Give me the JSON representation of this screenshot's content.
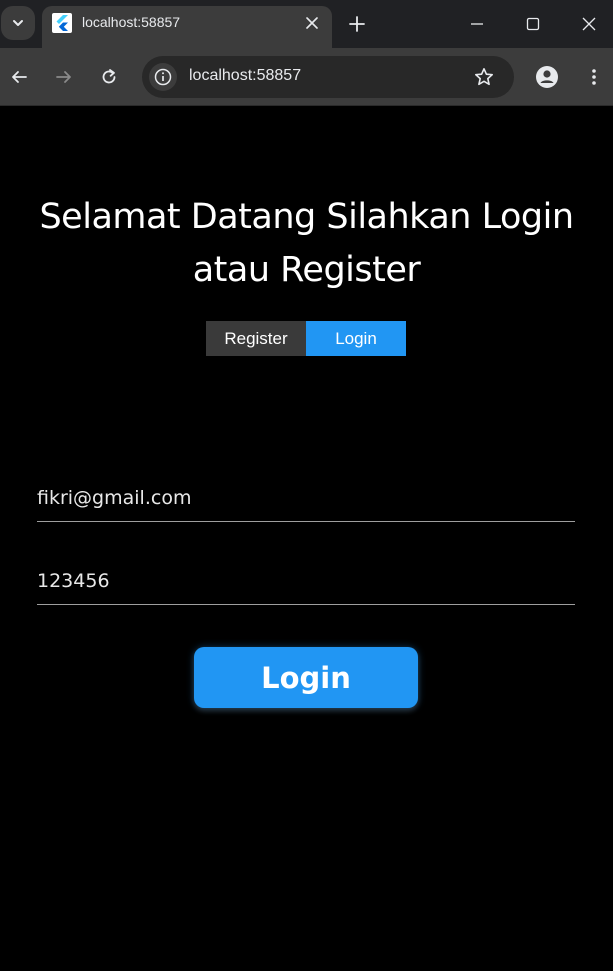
{
  "browser": {
    "tab_title": "localhost:58857",
    "url": "localhost:58857"
  },
  "page": {
    "headline": "Selamat Datang Silahkan Login atau Register",
    "toggle": {
      "register_label": "Register",
      "login_label": "Login",
      "active": "login"
    },
    "form": {
      "email_value": "fikri@gmail.com",
      "password_value": "123456",
      "submit_label": "Login"
    }
  },
  "colors": {
    "accent": "#2196f3",
    "background": "#000000",
    "inactive_toggle": "#3a3a3a"
  }
}
